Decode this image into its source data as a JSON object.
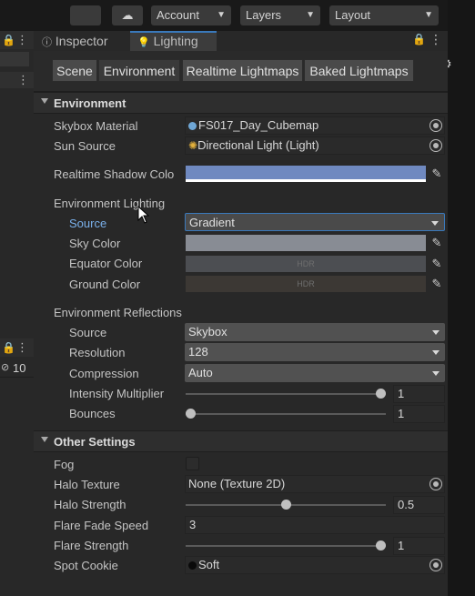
{
  "toolbar": {
    "account_label": "Account",
    "layers_label": "Layers",
    "layout_label": "Layout"
  },
  "left_panel": {
    "hidden_count": "10"
  },
  "tabs": {
    "inspector": "Inspector",
    "lighting": "Lighting"
  },
  "subtabs": [
    "Scene",
    "Environment",
    "Realtime Lightmaps",
    "Baked Lightmaps"
  ],
  "environment": {
    "header": "Environment",
    "skybox_material_label": "Skybox Material",
    "skybox_material_value": "FS017_Day_Cubemap",
    "sun_source_label": "Sun Source",
    "sun_source_value": "Directional Light (Light)",
    "realtime_shadow_label": "Realtime Shadow Colo",
    "realtime_shadow_color": "#6f89c0",
    "lighting": {
      "header": "Environment Lighting",
      "source_label": "Source",
      "source_value": "Gradient",
      "sky_color_label": "Sky Color",
      "sky_color": "#888c94",
      "equator_color_label": "Equator Color",
      "equator_color": "#4c4e52",
      "equator_hdr": "HDR",
      "ground_color_label": "Ground Color",
      "ground_color": "#3c3834",
      "ground_hdr": "HDR"
    },
    "reflections": {
      "header": "Environment Reflections",
      "source_label": "Source",
      "source_value": "Skybox",
      "resolution_label": "Resolution",
      "resolution_value": "128",
      "compression_label": "Compression",
      "compression_value": "Auto",
      "intensity_label": "Intensity Multiplier",
      "intensity_value": "1",
      "intensity_fraction": 1.0,
      "bounces_label": "Bounces",
      "bounces_value": "1",
      "bounces_fraction": 0.0
    }
  },
  "other_settings": {
    "header": "Other Settings",
    "fog_label": "Fog",
    "fog_checked": false,
    "halo_texture_label": "Halo Texture",
    "halo_texture_value": "None (Texture 2D)",
    "halo_strength_label": "Halo Strength",
    "halo_strength_value": "0.5",
    "halo_strength_fraction": 0.5,
    "flare_fade_label": "Flare Fade Speed",
    "flare_fade_value": "3",
    "flare_strength_label": "Flare Strength",
    "flare_strength_value": "1",
    "flare_strength_fraction": 1.0,
    "spot_cookie_label": "Spot Cookie",
    "spot_cookie_value": "Soft"
  },
  "colors": {
    "accent": "#3a79bb",
    "highlight_label": "#7ab0ea"
  }
}
